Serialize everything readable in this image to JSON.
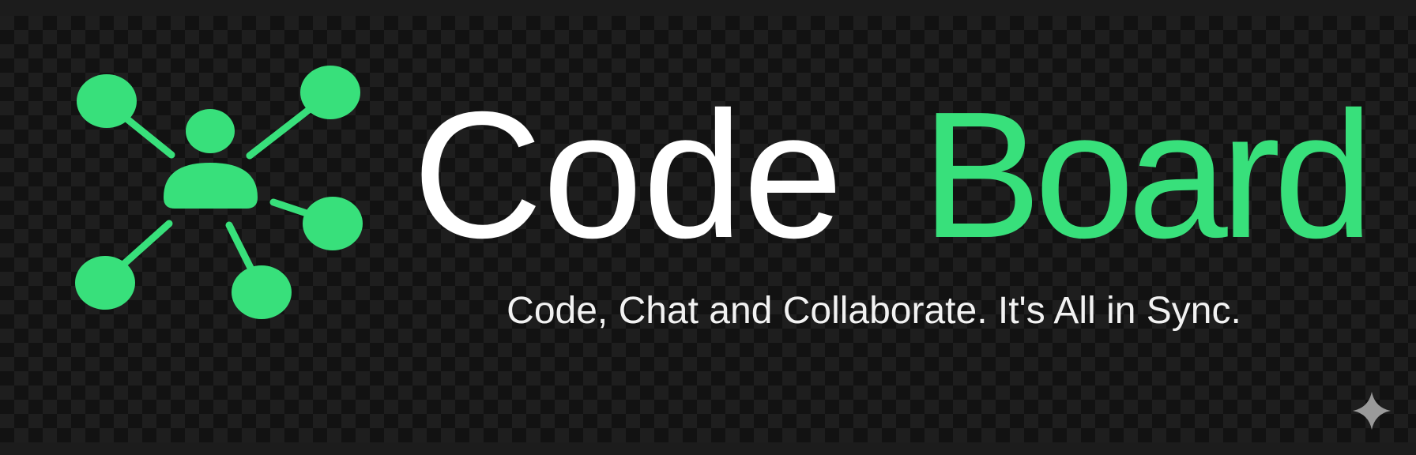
{
  "brand": {
    "name_part1": "Code",
    "name_part2": "Board",
    "tagline": "Code, Chat and Collaborate. It's All in Sync.",
    "logo_icon": "network-person-icon",
    "colors": {
      "accent": "#38e07b",
      "text": "#ffffff",
      "background": "#1c1c1c"
    }
  },
  "corner_icon": "sparkle-icon"
}
